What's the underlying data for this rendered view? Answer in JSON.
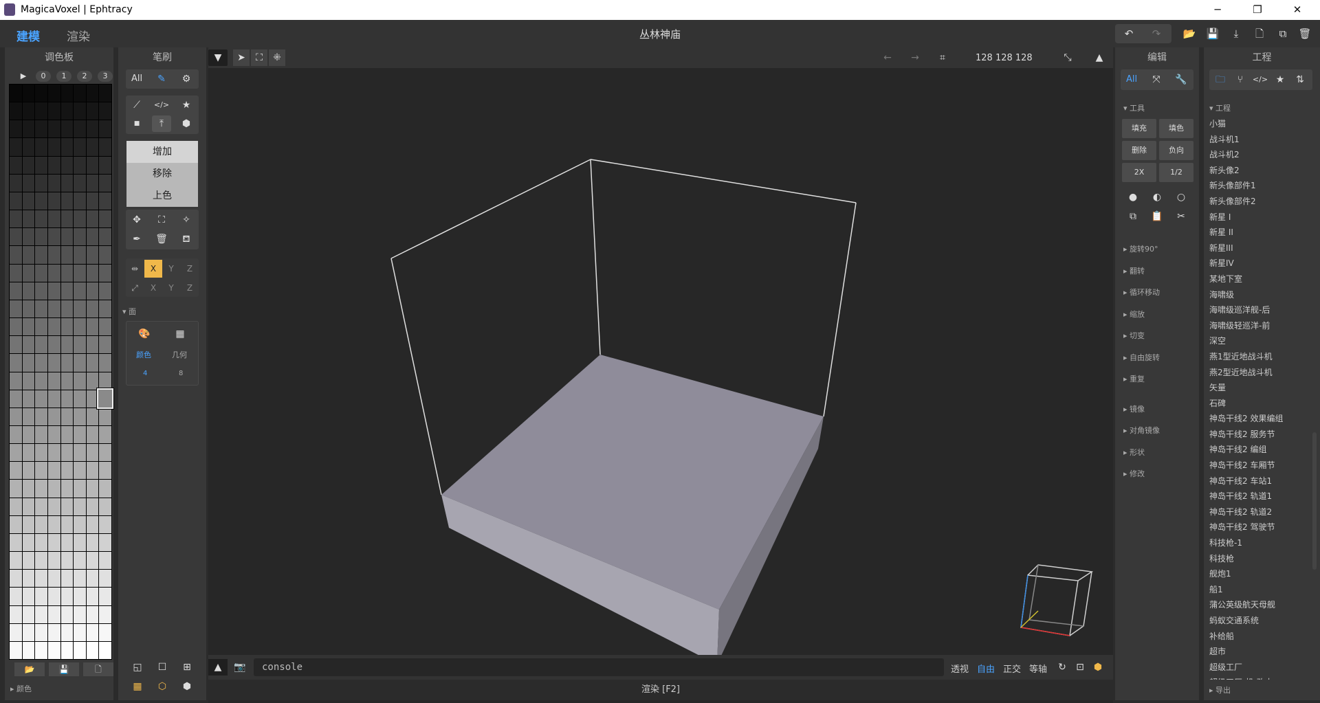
{
  "window": {
    "title": "MagicaVoxel | Ephtracy",
    "minimize": "─",
    "restore": "❐",
    "close": "✕"
  },
  "toolbar": {
    "mode_tabs": [
      "建模",
      "渲染"
    ],
    "doc_title": "丛林神庙",
    "icons": [
      "undo-icon",
      "redo-icon",
      "open-folder-icon",
      "save-icon",
      "export-icon",
      "new-file-icon",
      "copy-file-icon",
      "delete-icon"
    ],
    "accent": "#4aa3ff"
  },
  "palette": {
    "header": "调色板",
    "play": "▶",
    "tabs": [
      "0",
      "1",
      "2",
      "3"
    ],
    "footer_label": "颜色",
    "foot_icons": [
      "▣",
      "▤",
      "▥"
    ]
  },
  "brush": {
    "header": "笔刷",
    "filter_label": "All",
    "modes": [
      "增加",
      "移除",
      "上色"
    ],
    "axes": {
      "mirror": [
        "X",
        "Y",
        "Z"
      ],
      "axis": [
        "X",
        "Y",
        "Z"
      ]
    },
    "face_label": "面",
    "face_tabs": [
      "颜色",
      "几何"
    ],
    "face_values": [
      "4",
      "8"
    ],
    "highlight": "#f0b84a"
  },
  "viewport": {
    "size_readout": "128 128 128",
    "console_text": "console",
    "view_modes": [
      "透视",
      "自由",
      "正交",
      "等轴"
    ],
    "active_view": "自由",
    "status": "渲染 [F2]"
  },
  "edit": {
    "header": "编辑",
    "filter_label": "All",
    "tools_label": "▾ 工具",
    "buttons": [
      "填充",
      "填色",
      "删除",
      "负向",
      "2X",
      "1/2"
    ],
    "sections": [
      "▸ 旋转90°",
      "▸ 翻转",
      "▸ 循环移动",
      "▸ 缩放",
      "▸ 切变",
      "▸ 自由旋转",
      "▸ 重复",
      "▸ 镜像",
      "▸ 对角镜像",
      "▸ 形状",
      "▸ 修改"
    ]
  },
  "project": {
    "header": "工程",
    "tree_label": "▾ 工程",
    "export_label": "▸ 导出",
    "items": [
      "小猫",
      "战斗机1",
      "战斗机2",
      "新头像2",
      "新头像部件1",
      "新头像部件2",
      "新星 I",
      "新星 II",
      "新星III",
      "新星IV",
      "某地下室",
      "海啸级",
      "海啸级巡洋舰-后",
      "海啸级轻巡洋-前",
      "深空",
      "燕1型近地战斗机",
      "燕2型近地战斗机",
      "矢量",
      "石碑",
      "神岛干线2 效果编组",
      "神岛干线2 服务节",
      "神岛干线2 编组",
      "神岛干线2 车厢节",
      "神岛干线2 车站1",
      "神岛干线2 轨道1",
      "神岛干线2 轨道2",
      "神岛干线2 驾驶节",
      "科技枪-1",
      "科技枪",
      "舰炮1",
      "船1",
      "蒲公英级航天母舰",
      "蚂蚁交通系统",
      "补给船",
      "超市",
      "超级工厂",
      "超级工厂-机-改末"
    ]
  }
}
